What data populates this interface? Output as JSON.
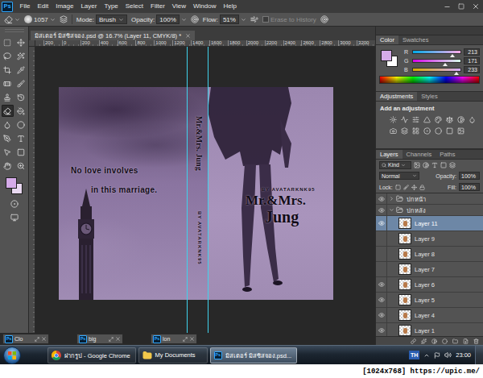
{
  "menu_bar": {
    "logo": "Ps",
    "items": [
      "File",
      "Edit",
      "Image",
      "Layer",
      "Type",
      "Select",
      "Filter",
      "View",
      "Window",
      "Help"
    ]
  },
  "options_bar": {
    "brush_size": "1057",
    "mode_label": "Mode:",
    "mode": "Brush",
    "opacity_label": "Opacity:",
    "opacity": "100%",
    "flow_label": "Flow:",
    "flow": "51%",
    "erase_to_history": {
      "label": "Erase to History",
      "checked": false,
      "disabled": true
    }
  },
  "toolbox": {
    "tools": [
      {
        "selected": false
      },
      {
        "selected": false
      },
      {
        "selected": false
      },
      {
        "selected": false
      },
      {
        "selected": false
      },
      {
        "selected": false
      },
      {
        "selected": false
      },
      {
        "selected": false
      },
      {
        "selected": false
      },
      {
        "selected": false
      },
      {
        "selected": true
      },
      {
        "selected": false
      },
      {
        "selected": false
      },
      {
        "selected": false
      },
      {
        "selected": false
      },
      {
        "selected": false
      },
      {
        "selected": false
      },
      {
        "selected": false
      },
      {
        "selected": false
      },
      {
        "selected": false
      }
    ],
    "foreground": "#d5abe9",
    "background": "#e9d9f1"
  },
  "document": {
    "tab": {
      "label": "มิสเตอร์ มิสซิสจอง.psd @ 16.7% (Layer 11, CMYK/8) *",
      "selected": true
    },
    "ruler": [
      "200",
      "0",
      "200",
      "400",
      "600",
      "800",
      "1000",
      "1200",
      "1400",
      "1600",
      "1800",
      "2000",
      "2200",
      "2400",
      "2600",
      "2800",
      "3000",
      "3200"
    ],
    "cover": {
      "tagline": [
        "No love involves",
        "in this marriage."
      ],
      "spine_title": "Mr.&Mrs. Jung",
      "spine_author": "BY AVATARKNK95",
      "front_author": "BY AVATARKNK95",
      "front_title": [
        "Mr.&Mrs.",
        "Jung"
      ]
    }
  },
  "minimized_documents": [
    {
      "label": "Clo"
    },
    {
      "label": "big"
    },
    {
      "label": "lon"
    }
  ],
  "color_panel": {
    "tabs": [
      {
        "label": "Color",
        "selected": true
      },
      {
        "label": "Swatches",
        "selected": false
      }
    ],
    "foreground": "#d5abe9",
    "background": "#ffffff",
    "channels": [
      {
        "name": "R",
        "value": "213",
        "level": 0.835
      },
      {
        "name": "G",
        "value": "171",
        "level": 0.671
      },
      {
        "name": "B",
        "value": "233",
        "level": 0.914
      }
    ]
  },
  "adjustments_panel": {
    "tabs": [
      {
        "label": "Adjustments",
        "selected": true
      },
      {
        "label": "Styles",
        "selected": false
      }
    ],
    "title": "Add an adjustment"
  },
  "layers_panel": {
    "tabs": [
      {
        "label": "Layers",
        "selected": true
      },
      {
        "label": "Channels",
        "selected": false
      },
      {
        "label": "Paths",
        "selected": false
      }
    ],
    "filter": "Kind",
    "blend_mode": "Normal",
    "opacity_label": "Opacity:",
    "opacity": "100%",
    "lock_label": "Lock:",
    "fill_label": "Fill:",
    "fill": "100%",
    "layers": [
      {
        "name": "ปกหน้า",
        "kind": "group",
        "visible": true,
        "expanded": false,
        "selected": false
      },
      {
        "name": "ปกหลัง",
        "kind": "group",
        "visible": true,
        "expanded": true,
        "selected": false
      },
      {
        "name": "Layer 11",
        "kind": "layer",
        "visible": true,
        "expanded": false,
        "selected": true
      },
      {
        "name": "Layer 9",
        "kind": "layer",
        "visible": false,
        "expanded": false,
        "selected": false
      },
      {
        "name": "Layer 8",
        "kind": "layer",
        "visible": false,
        "expanded": false,
        "selected": false
      },
      {
        "name": "Layer 7",
        "kind": "layer",
        "visible": false,
        "expanded": false,
        "selected": false
      },
      {
        "name": "Layer 6",
        "kind": "layer",
        "visible": true,
        "expanded": false,
        "selected": false
      },
      {
        "name": "Layer 5",
        "kind": "layer",
        "visible": true,
        "expanded": false,
        "selected": false
      },
      {
        "name": "Layer 4",
        "kind": "layer",
        "visible": true,
        "expanded": false,
        "selected": false
      },
      {
        "name": "Layer 1",
        "kind": "layer",
        "visible": true,
        "expanded": false,
        "selected": false
      }
    ]
  },
  "taskbar": {
    "buttons": [
      {
        "label": "ฝากรูป - Google Chrome",
        "kind": "chrome",
        "selected": false
      },
      {
        "label": "My Documents",
        "kind": "folder",
        "selected": false
      },
      {
        "label": "มิสเตอร์ มิสซิสจอง.psd...",
        "kind": "photoshop",
        "selected": true
      }
    ],
    "language": "TH",
    "clock": "23:00"
  },
  "watermark": "[1024x768] https://upic.me/"
}
